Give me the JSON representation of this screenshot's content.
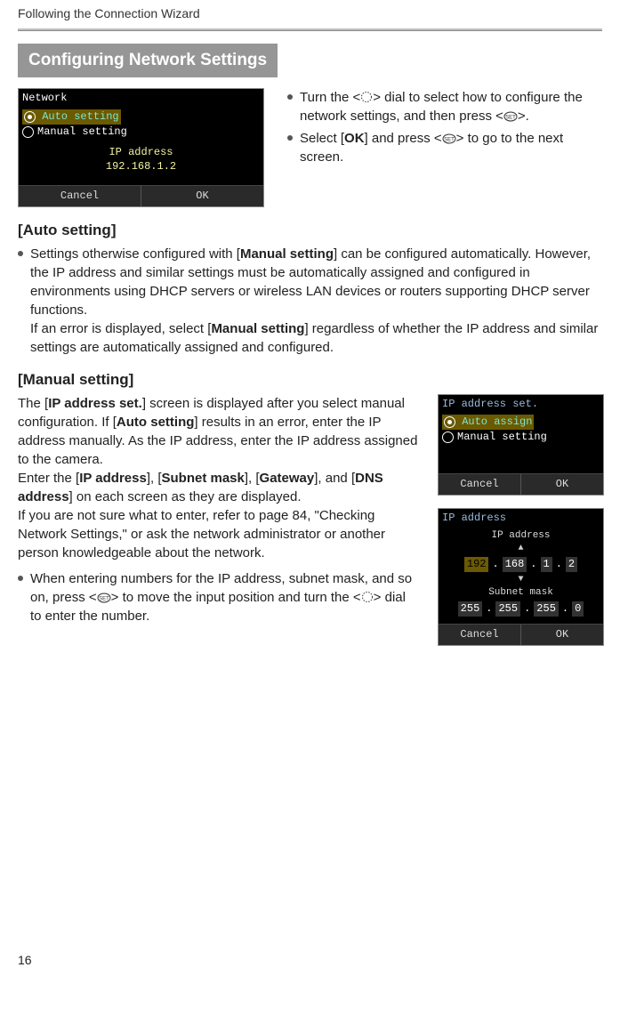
{
  "header": {
    "running": "Following the Connection Wizard"
  },
  "section": {
    "title": "Configuring Network Settings"
  },
  "shot1": {
    "title": "Network",
    "opt1": "Auto setting",
    "opt2": "Manual setting",
    "line1": "IP address",
    "line2": "192.168.1.2",
    "btn_cancel": "Cancel",
    "btn_ok": "OK"
  },
  "top_bullets": {
    "b1a": "Turn the <",
    "b1b": "> dial to select how to configure the network settings, and then press <",
    "b1c": ">.",
    "b2a": "Select [",
    "b2b": "OK",
    "b2c": "] and press <",
    "b2d": "> to go to the next screen."
  },
  "auto": {
    "heading": "[Auto setting]",
    "p1a": "Settings otherwise configured with [",
    "p1b": "Manual setting",
    "p1c": "] can be configured automatically. However, the IP address and similar settings must be automatically assigned and configured in environments using DHCP servers or wireless LAN devices or routers supporting DHCP server functions.",
    "p2a": "If an error is displayed, select [",
    "p2b": "Manual setting",
    "p2c": "] regardless of whether the IP address and similar settings are automatically assigned and configured."
  },
  "manual": {
    "heading": "[Manual setting]",
    "p1a": "The [",
    "p1b": "IP address set.",
    "p1c": "] screen is displayed after you select manual configuration. If [",
    "p1d": "Auto setting",
    "p1e": "] results in an error, enter the IP address manually. As the IP address, enter the IP address assigned to the camera.",
    "p2a": "Enter the [",
    "p2b": "IP address",
    "p2c": "], [",
    "p2d": "Subnet mask",
    "p2e": "], [",
    "p2f": "Gateway",
    "p2g": "], and [",
    "p2h": "DNS address",
    "p2i": "] on each screen as they are displayed.",
    "p3": "If you are not sure what to enter, refer to page 84, \"Checking Network Settings,\" or ask the network administrator or another person knowledgeable about the network.",
    "b1a": "When entering numbers for the IP address, subnet mask, and so on, press <",
    "b1b": "> to move the input position and turn the <",
    "b1c": "> dial to enter the number."
  },
  "shot2": {
    "title": "IP address set.",
    "opt1": "Auto assign",
    "opt2": "Manual setting",
    "btn_cancel": "Cancel",
    "btn_ok": "OK"
  },
  "shot3": {
    "title": "IP address",
    "lbl_ip": "IP address",
    "ip1": "192",
    "ip2": "168",
    "ip3": "1",
    "ip4": "2",
    "lbl_mask": "Subnet mask",
    "m1": "255",
    "m2": "255",
    "m3": "255",
    "m4": "0",
    "btn_cancel": "Cancel",
    "btn_ok": "OK"
  },
  "page_number": "16"
}
